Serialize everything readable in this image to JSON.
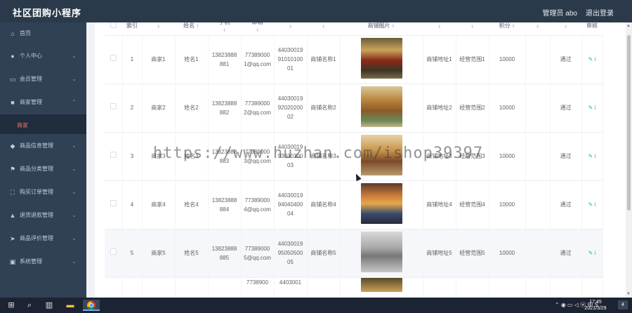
{
  "app": {
    "title": "社区团购小程序",
    "admin_label": "管理员 abo",
    "logout_label": "退出登录"
  },
  "sidebar": {
    "items": [
      {
        "label": "首页",
        "icon": "home-icon",
        "glyph": "⌂",
        "chevron": ""
      },
      {
        "label": "个人中心",
        "icon": "user-icon",
        "glyph": "●",
        "chevron": "⌄"
      },
      {
        "label": "会员管理",
        "icon": "chat-icon",
        "glyph": "▭",
        "chevron": "⌄"
      },
      {
        "label": "商家管理",
        "icon": "shop-icon",
        "glyph": "■",
        "chevron": "⌃"
      },
      {
        "label": "商品信息管理",
        "icon": "location-icon",
        "glyph": "◆",
        "chevron": "⌄"
      },
      {
        "label": "商品分类管理",
        "icon": "flag-icon",
        "glyph": "⚑",
        "chevron": "⌄"
      },
      {
        "label": "购买订单管理",
        "icon": "expand-icon",
        "glyph": "⛶",
        "chevron": "⌄"
      },
      {
        "label": "退货退款管理",
        "icon": "person-icon",
        "glyph": "▲",
        "chevron": "⌄"
      },
      {
        "label": "商品评价管理",
        "icon": "send-icon",
        "glyph": "➤",
        "chevron": "⌄"
      },
      {
        "label": "系统管理",
        "icon": "trash-icon",
        "glyph": "▣",
        "chevron": "⌄"
      }
    ],
    "submenu": {
      "label": "商家"
    }
  },
  "table": {
    "headers": [
      "索引",
      "",
      "姓名",
      "手机",
      "邮箱",
      "",
      "",
      "商铺图片",
      "",
      "",
      "积分",
      "",
      "",
      "审核"
    ],
    "rows": [
      {
        "index": "1",
        "account": "商家1",
        "name": "姓名1",
        "phone": "13823888881",
        "email": "773890001@qq.com",
        "idno": "440300199101010001",
        "shop": "商铺名称1",
        "addr": "商铺地址1",
        "scope": "经营范围1",
        "points": "10000",
        "status": "通过",
        "op": "✎ i"
      },
      {
        "index": "2",
        "account": "商家2",
        "name": "姓名2",
        "phone": "13823888882",
        "email": "773890002@qq.com",
        "idno": "440300199202020002",
        "shop": "商铺名称2",
        "addr": "商铺地址2",
        "scope": "经营范围2",
        "points": "10000",
        "status": "通过",
        "op": "✎ i"
      },
      {
        "index": "3",
        "account": "商家3",
        "name": "姓名3",
        "phone": "13823888883",
        "email": "773890003@qq.com",
        "idno": "440300199303030003",
        "shop": "商铺名称3",
        "addr": "商铺地址3",
        "scope": "经营范围3",
        "points": "10000",
        "status": "通过",
        "op": "✎ i"
      },
      {
        "index": "4",
        "account": "商家4",
        "name": "姓名4",
        "phone": "13823888884",
        "email": "773890004@qq.com",
        "idno": "440300199404040004",
        "shop": "商铺名称4",
        "addr": "商铺地址4",
        "scope": "经营范围4",
        "points": "10000",
        "status": "通过",
        "op": "✎ i"
      },
      {
        "index": "5",
        "account": "商家5",
        "name": "姓名5",
        "phone": "13823888885",
        "email": "773890005@qq.com",
        "idno": "440300199505050005",
        "shop": "商铺名称5",
        "addr": "商铺地址5",
        "scope": "经营范围5",
        "points": "10000",
        "status": "通过",
        "op": "✎ i"
      }
    ],
    "partial_row": {
      "email": "7738900",
      "idno": "4403001"
    }
  },
  "watermark": "https://www.huzhan.com/ishop39397",
  "taskbar": {
    "tray_text": "⌃ ◉ ▭ ◁ ⓦ 中 S",
    "time": "17:45",
    "date": "2021/3/29",
    "notify_count": "4"
  },
  "colors": {
    "topbar": "#2b3a4a",
    "sidebar": "#304156",
    "accent_red": "#f56c6c",
    "op_green": "#13ce66"
  }
}
